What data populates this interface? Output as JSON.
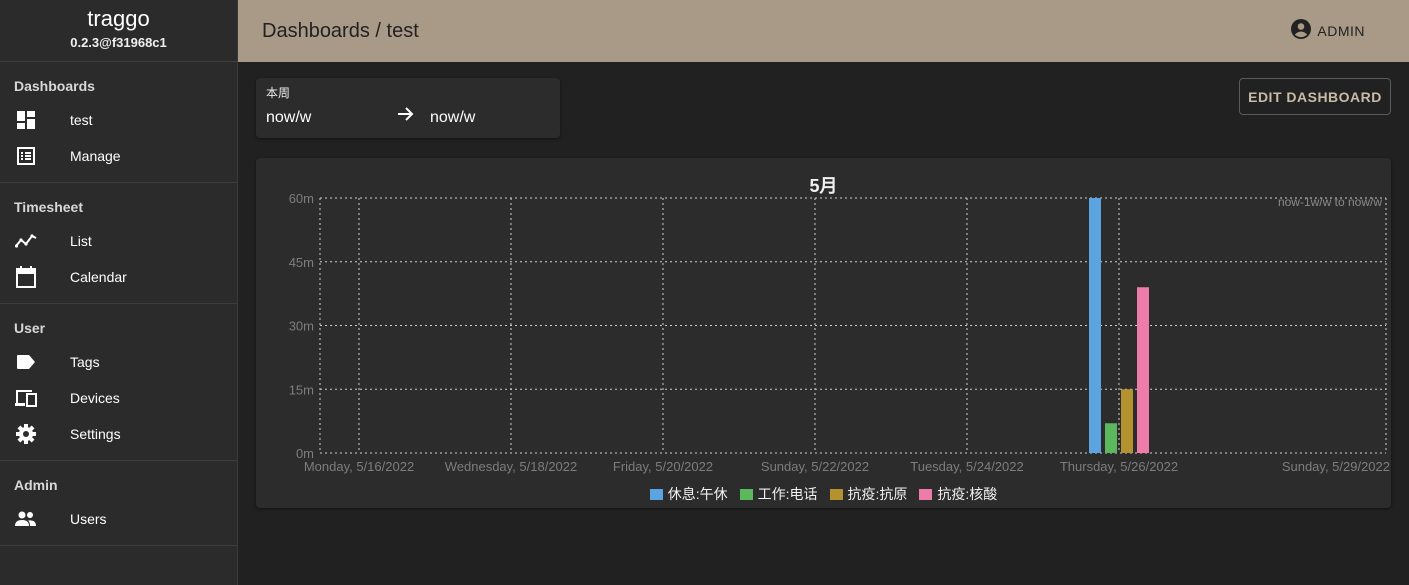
{
  "app": {
    "name": "traggo",
    "version": "0.2.3@f31968c1"
  },
  "sidebar": {
    "sections": [
      {
        "title": "Dashboards",
        "items": [
          {
            "label": "test",
            "icon": "dashboard-icon"
          },
          {
            "label": "Manage",
            "icon": "list-icon"
          }
        ]
      },
      {
        "title": "Timesheet",
        "items": [
          {
            "label": "List",
            "icon": "timeline-icon"
          },
          {
            "label": "Calendar",
            "icon": "calendar-icon"
          }
        ]
      },
      {
        "title": "User",
        "items": [
          {
            "label": "Tags",
            "icon": "tag-icon"
          },
          {
            "label": "Devices",
            "icon": "devices-icon"
          },
          {
            "label": "Settings",
            "icon": "gear-icon"
          }
        ]
      },
      {
        "title": "Admin",
        "items": [
          {
            "label": "Users",
            "icon": "people-icon"
          }
        ]
      }
    ]
  },
  "header": {
    "breadcrumb": "Dashboards / test",
    "user_label": "ADMIN"
  },
  "range": {
    "label": "本周",
    "from": "now/w",
    "to": "now/w"
  },
  "edit_button": "EDIT DASHBOARD",
  "colors": {
    "header_bg": "#a89a86",
    "sidebar_bg": "#2b2b2b",
    "main_bg": "#212121",
    "card_bg": "#2c2c2c"
  },
  "chart_data": {
    "type": "bar",
    "title": "5月",
    "annotation": "now-1w/w to now/w",
    "x_tick_labels": [
      "Monday, 5/16/2022",
      "Wednesday, 5/18/2022",
      "Friday, 5/20/2022",
      "Sunday, 5/22/2022",
      "Tuesday, 5/24/2022",
      "Thursday, 5/26/2022",
      "Sunday, 5/29/2022"
    ],
    "y_tick_labels": [
      "0m",
      "15m",
      "30m",
      "45m",
      "60m"
    ],
    "ylim": [
      0,
      60
    ],
    "grid": true,
    "legend_position": "bottom-center",
    "categories": [
      "Thursday, 5/26/2022"
    ],
    "series": [
      {
        "name": "休息:午休",
        "color": "#5ba4e0",
        "values": [
          60
        ]
      },
      {
        "name": "工作:电话",
        "color": "#5cb85c",
        "values": [
          7
        ]
      },
      {
        "name": "抗疫:抗原",
        "color": "#b3922f",
        "values": [
          15
        ]
      },
      {
        "name": "抗疫:核酸",
        "color": "#ee7cab",
        "values": [
          39
        ]
      }
    ]
  }
}
